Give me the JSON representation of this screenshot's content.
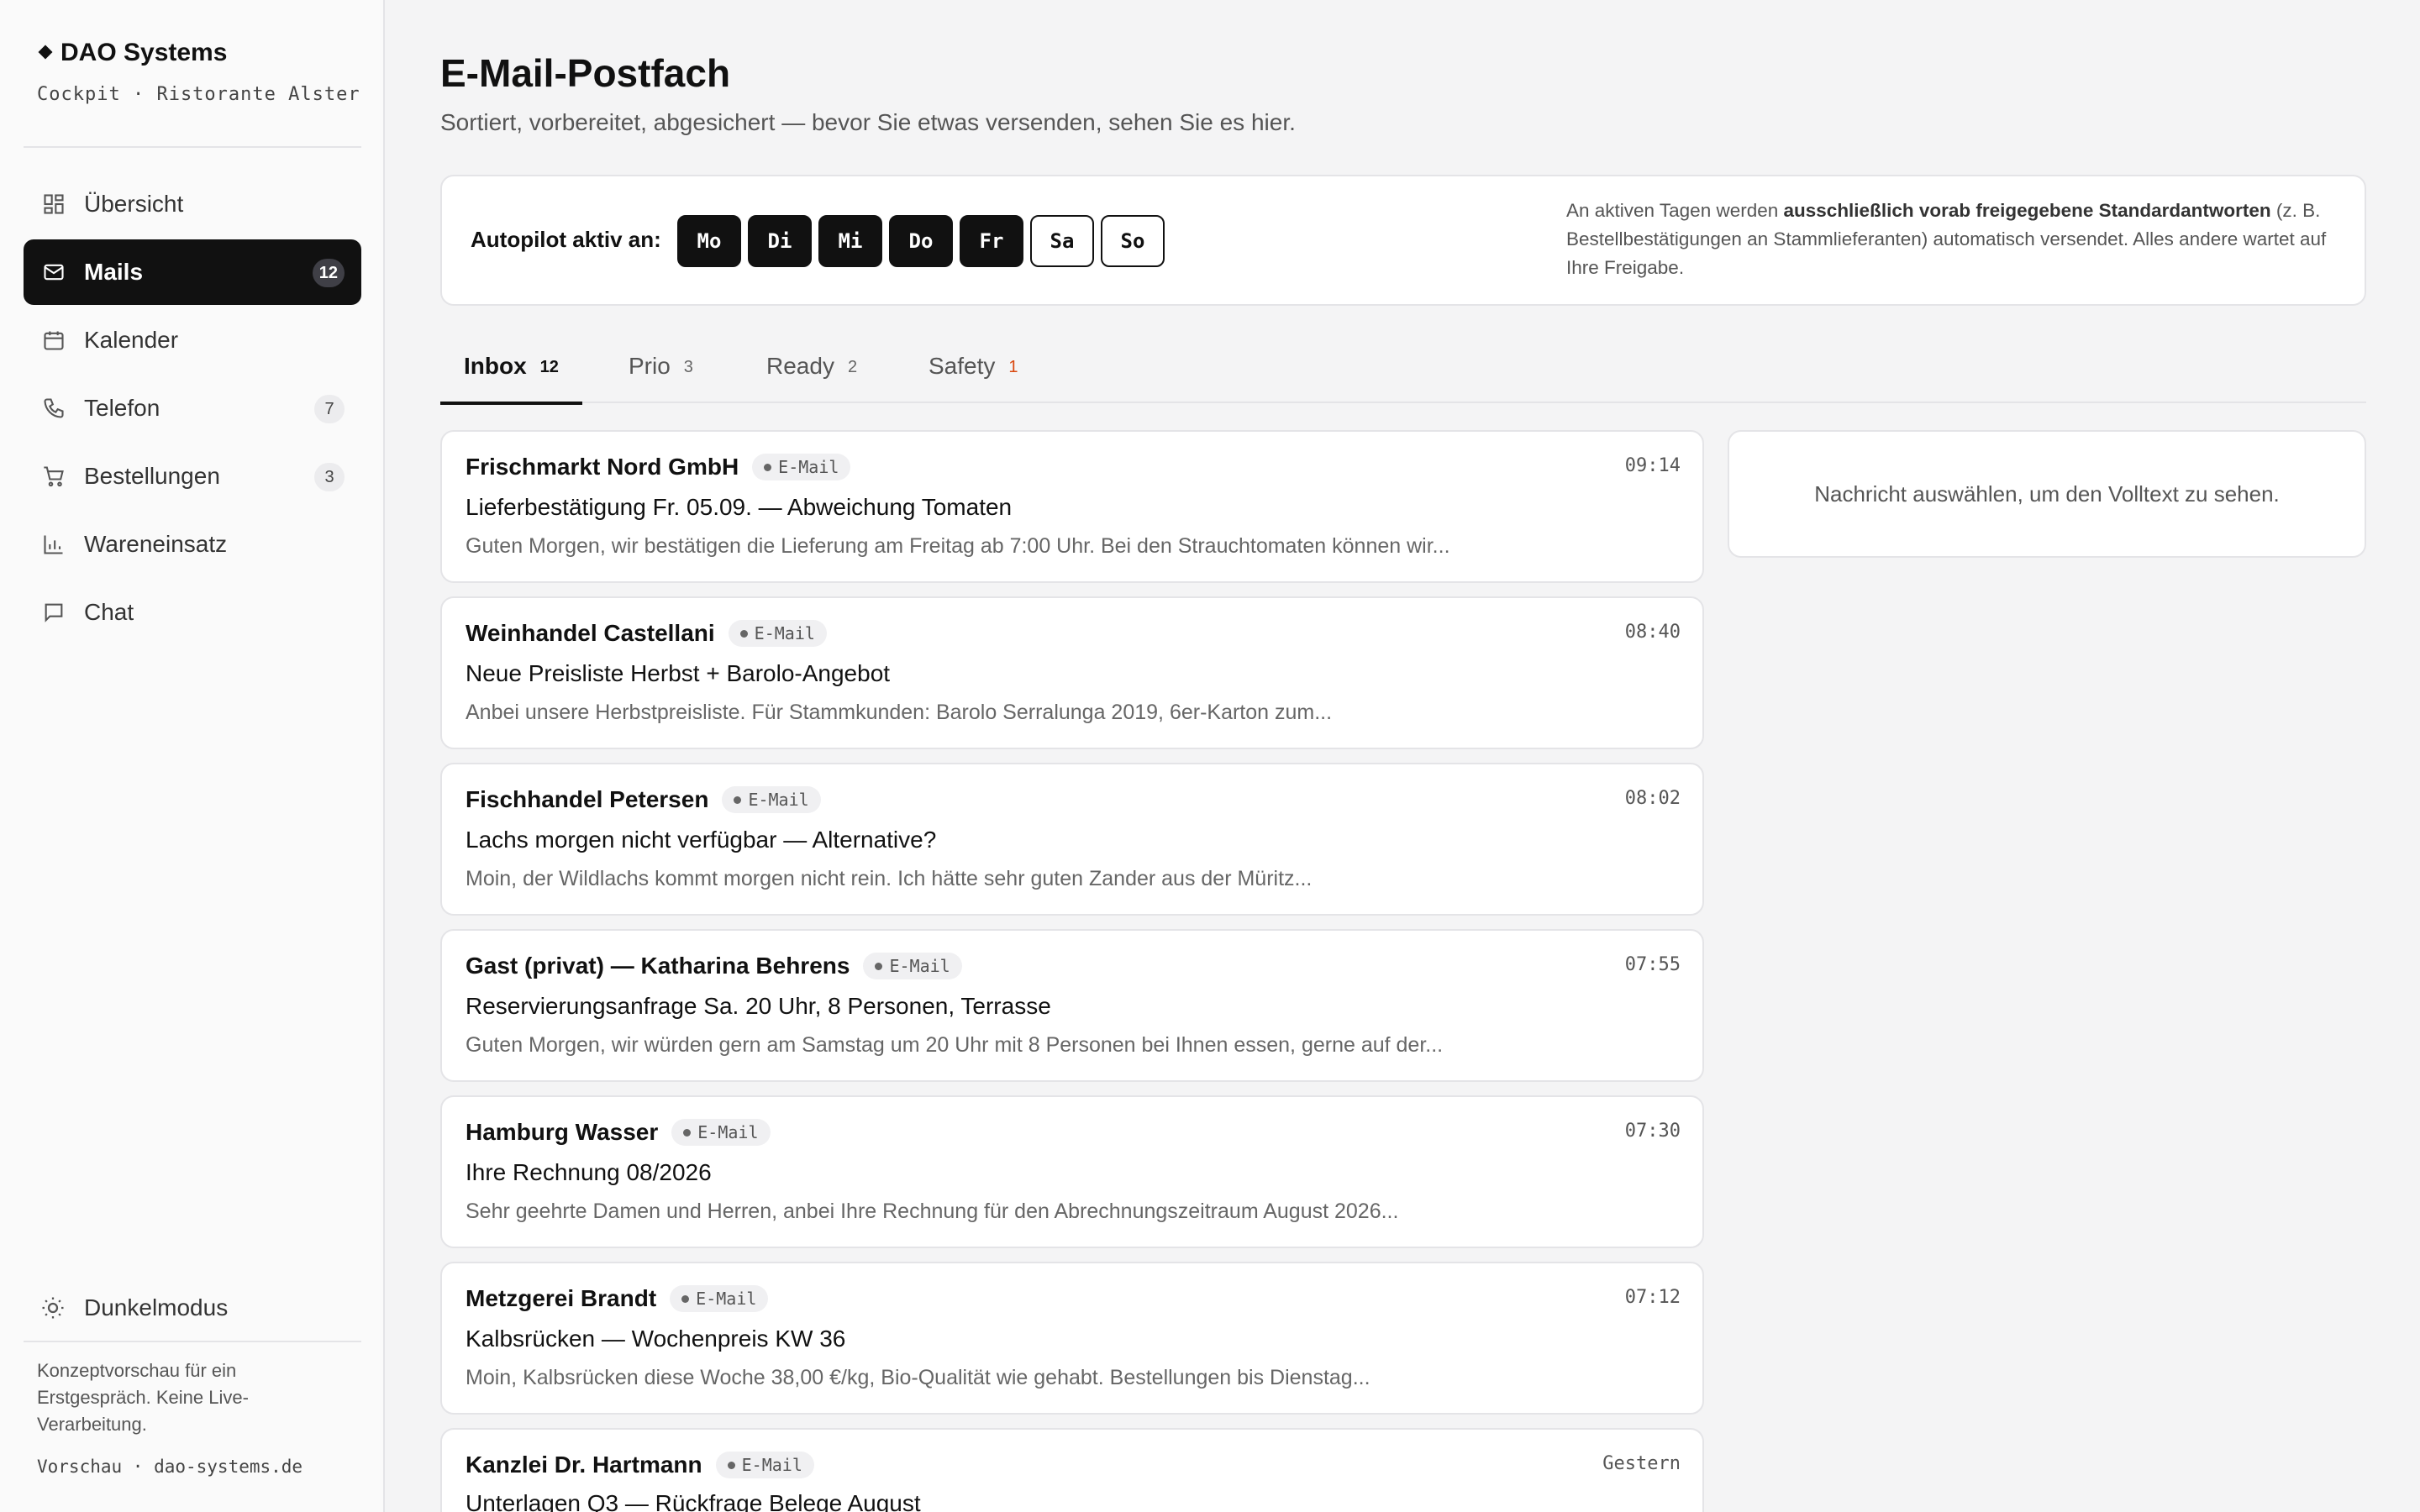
{
  "sidebar": {
    "brand": "DAO Systems",
    "subtitle": "Cockpit · Ristorante Alster",
    "items": [
      {
        "label": "Übersicht",
        "icon": "grid-icon",
        "badge": ""
      },
      {
        "label": "Mails",
        "icon": "mail-icon",
        "badge": "12",
        "active": true
      },
      {
        "label": "Kalender",
        "icon": "calendar-icon",
        "badge": ""
      },
      {
        "label": "Telefon",
        "icon": "phone-icon",
        "badge": "7"
      },
      {
        "label": "Bestellungen",
        "icon": "cart-icon",
        "badge": "3"
      },
      {
        "label": "Wareneinsatz",
        "icon": "bar-chart-icon",
        "badge": ""
      },
      {
        "label": "Chat",
        "icon": "chat-icon",
        "badge": ""
      }
    ],
    "dark_mode_label": "Dunkelmodus",
    "note": "Konzeptvorschau für ein Erstgespräch. Keine Live-Verarbeitung.",
    "footer": "Vorschau · dao-systems.de"
  },
  "header": {
    "title": "E-Mail-Postfach",
    "subtitle": "Sortiert, vorbereitet, abgesichert — bevor Sie etwas versenden, sehen Sie es hier."
  },
  "autopilot": {
    "label": "Autopilot aktiv an:",
    "days": [
      {
        "label": "Mo",
        "active": true
      },
      {
        "label": "Di",
        "active": true
      },
      {
        "label": "Mi",
        "active": true
      },
      {
        "label": "Do",
        "active": true
      },
      {
        "label": "Fr",
        "active": true
      },
      {
        "label": "Sa",
        "active": false
      },
      {
        "label": "So",
        "active": false
      }
    ],
    "note_prefix": "An aktiven Tagen werden ",
    "note_bold": "ausschließlich vorab freigegebene Standardantworten",
    "note_suffix": " (z. B. Bestellbestätigungen an Stammlieferanten) automatisch versendet. Alles andere wartet auf Ihre Freigabe."
  },
  "tabs": [
    {
      "label": "Inbox",
      "count": "12",
      "active": true
    },
    {
      "label": "Prio",
      "count": "3"
    },
    {
      "label": "Ready",
      "count": "2"
    },
    {
      "label": "Safety",
      "count": "1",
      "alert": true
    }
  ],
  "messages": [
    {
      "from": "Frischmarkt Nord GmbH",
      "channel": "E-Mail",
      "time": "09:14",
      "subject": "Lieferbestätigung Fr. 05.09. — Abweichung Tomaten",
      "preview": "Guten Morgen, wir bestätigen die Lieferung am Freitag ab 7:00 Uhr. Bei den Strauchtomaten können wir..."
    },
    {
      "from": "Weinhandel Castellani",
      "channel": "E-Mail",
      "time": "08:40",
      "subject": "Neue Preisliste Herbst + Barolo-Angebot",
      "preview": "Anbei unsere Herbstpreisliste. Für Stammkunden: Barolo Serralunga 2019, 6er-Karton zum..."
    },
    {
      "from": "Fischhandel Petersen",
      "channel": "E-Mail",
      "time": "08:02",
      "subject": "Lachs morgen nicht verfügbar — Alternative?",
      "preview": "Moin, der Wildlachs kommt morgen nicht rein. Ich hätte sehr guten Zander aus der Müritz..."
    },
    {
      "from": "Gast (privat) — Katharina Behrens",
      "channel": "E-Mail",
      "time": "07:55",
      "subject": "Reservierungsanfrage Sa. 20 Uhr, 8 Personen, Terrasse",
      "preview": "Guten Morgen, wir würden gern am Samstag um 20 Uhr mit 8 Personen bei Ihnen essen, gerne auf der..."
    },
    {
      "from": "Hamburg Wasser",
      "channel": "E-Mail",
      "time": "07:30",
      "subject": "Ihre Rechnung 08/2026",
      "preview": "Sehr geehrte Damen und Herren, anbei Ihre Rechnung für den Abrechnungszeitraum August 2026..."
    },
    {
      "from": "Metzgerei Brandt",
      "channel": "E-Mail",
      "time": "07:12",
      "subject": "Kalbsrücken — Wochenpreis KW 36",
      "preview": "Moin, Kalbsrücken diese Woche 38,00 €/kg, Bio-Qualität wie gehabt. Bestellungen bis Dienstag..."
    },
    {
      "from": "Kanzlei Dr. Hartmann",
      "channel": "E-Mail",
      "time": "Gestern",
      "subject": "Unterlagen Q3 — Rückfrage Belege August",
      "preview": ""
    }
  ],
  "detail": {
    "placeholder": "Nachricht auswählen, um den Volltext zu sehen."
  }
}
